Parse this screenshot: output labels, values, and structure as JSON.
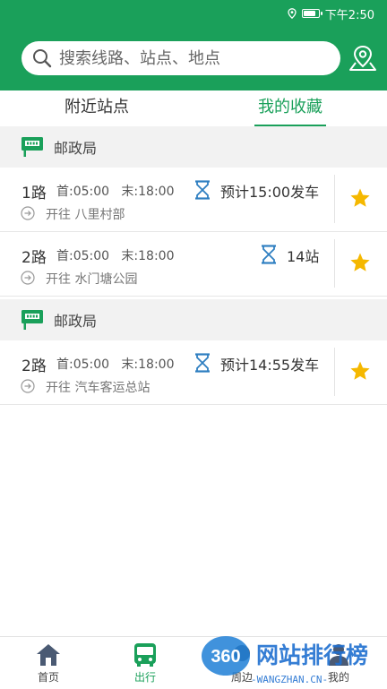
{
  "status": {
    "time": "下午2:50",
    "battery_level": 0.85
  },
  "search": {
    "placeholder": "搜索线路、站点、地点"
  },
  "tabs": [
    {
      "label": "附近站点",
      "active": false
    },
    {
      "label": "我的收藏",
      "active": true
    }
  ],
  "stops": [
    {
      "name": "邮政局",
      "routes": [
        {
          "number": "1路",
          "times": "首:05:00   末:18:00",
          "direction": "开往 八里村部",
          "eta": "预计15:00发车",
          "favorite": true
        },
        {
          "number": "2路",
          "times": "首:05:00   末:18:00",
          "direction": "开往 水门塘公园",
          "eta": "14站",
          "favorite": true
        }
      ]
    },
    {
      "name": "邮政局",
      "routes": [
        {
          "number": "2路",
          "times": "首:05:00   末:18:00",
          "direction": "开往 汽车客运总站",
          "eta": "预计14:55发车",
          "favorite": true
        }
      ]
    }
  ],
  "nav": [
    {
      "label": "首页",
      "icon": "home-icon"
    },
    {
      "label": "出行",
      "icon": "bus-icon",
      "active": true
    },
    {
      "label": "周边",
      "icon": "nearby-icon"
    },
    {
      "label": "我的",
      "icon": "user-icon"
    }
  ],
  "watermark": {
    "number": "360",
    "text": "网站排行榜",
    "url": "-WANGZHAN.CN-"
  },
  "colors": {
    "brand": "#1aa05a",
    "star": "#f5b800",
    "hourglass": "#2f7fc1"
  }
}
